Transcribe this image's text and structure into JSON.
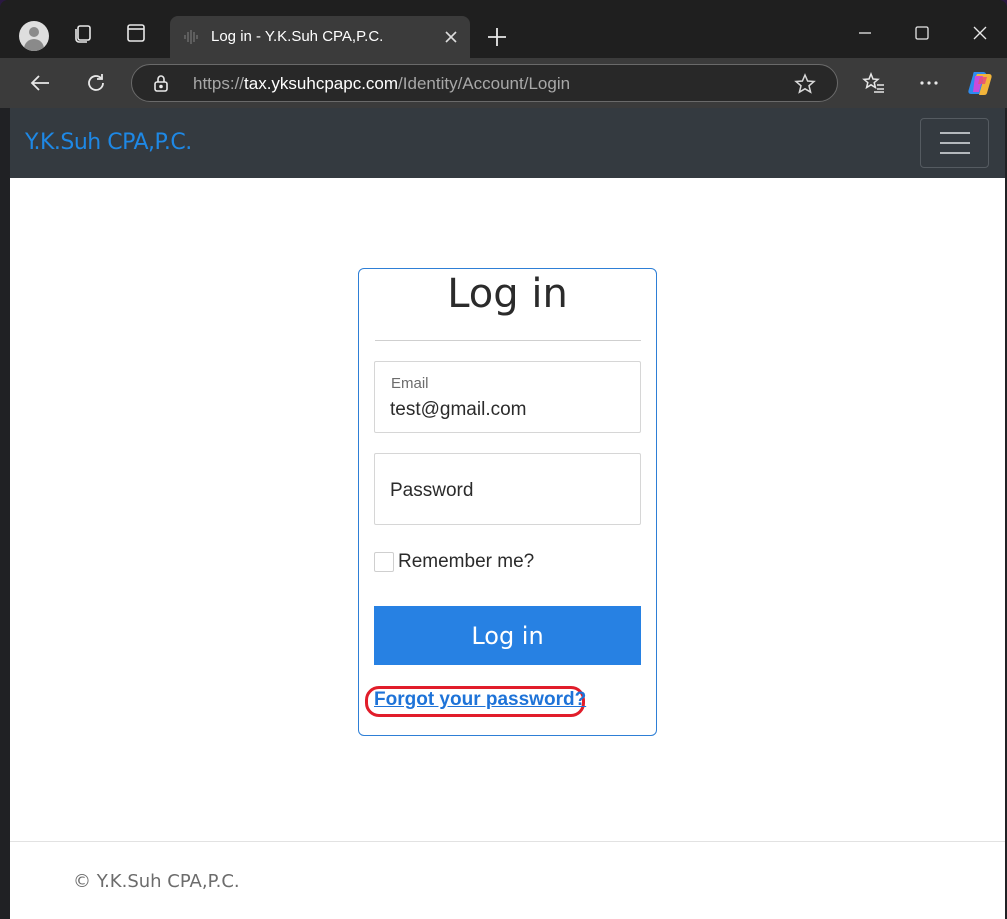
{
  "browser": {
    "tab_title": "Log in - Y.K.Suh CPA,P.C.",
    "url_prefix": "https://",
    "url_host": "tax.yksuhcpapc.com",
    "url_path": "/Identity/Account/Login"
  },
  "navbar": {
    "brand": "Y.K.Suh CPA,P.C."
  },
  "login": {
    "heading": "Log in",
    "email_label": "Email",
    "email_value": "test@gmail.com",
    "password_placeholder": "Password",
    "remember_label": "Remember me?",
    "submit_label": "Log in",
    "forgot_link": "Forgot your password?"
  },
  "footer": {
    "copyright": "© Y.K.Suh CPA,P.C."
  },
  "colors": {
    "brand": "#1e88e5",
    "navbar_bg": "#343a40",
    "button_bg": "#2781e3",
    "highlight": "#e11d2a"
  }
}
